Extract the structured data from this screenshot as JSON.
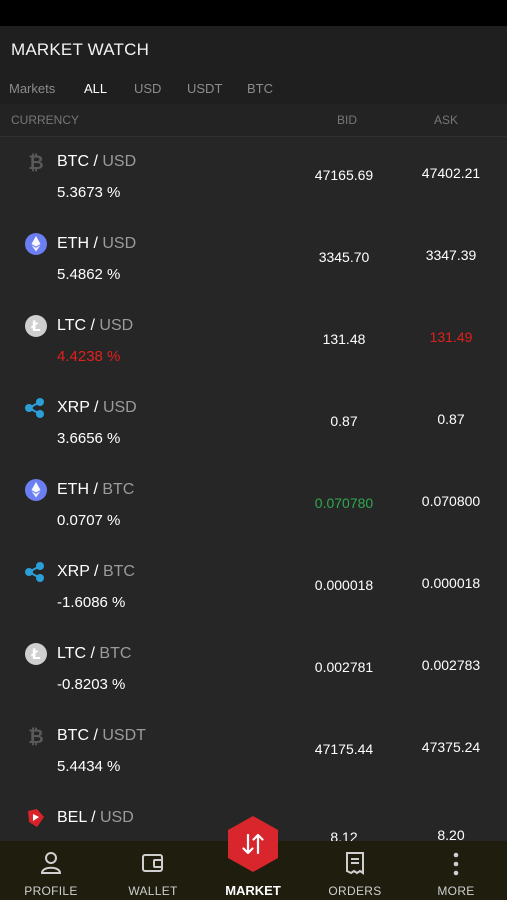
{
  "header": {
    "title": "MARKET WATCH"
  },
  "tabs": [
    "Markets",
    "ALL",
    "USD",
    "USDT",
    "BTC"
  ],
  "columns": {
    "currency": "CURRENCY",
    "bid": "BID",
    "ask": "ASK"
  },
  "rows": [
    {
      "base": "BTC",
      "sep": " / ",
      "quote": "USD",
      "change": "5.3673 %",
      "bid": "47165.69",
      "ask": "47402.21",
      "icon": "bitcoin-icon"
    },
    {
      "base": "ETH",
      "sep": " / ",
      "quote": "USD",
      "change": "5.4862 %",
      "bid": "3345.70",
      "ask": "3347.39",
      "icon": "ethereum-icon"
    },
    {
      "base": "LTC",
      "sep": " / ",
      "quote": "USD",
      "change": "4.4238 %",
      "bid": "131.48",
      "ask": "131.49",
      "icon": "litecoin-icon"
    },
    {
      "base": "XRP",
      "sep": " / ",
      "quote": "USD",
      "change": "3.6656 %",
      "bid": "0.87",
      "ask": "0.87",
      "icon": "xrp-icon"
    },
    {
      "base": "ETH",
      "sep": " / ",
      "quote": "BTC",
      "change": "0.0707 %",
      "bid": "0.070780",
      "ask": "0.070800",
      "icon": "ethereum-icon"
    },
    {
      "base": "XRP",
      "sep": " / ",
      "quote": "BTC",
      "change": "-1.6086 %",
      "bid": "0.000018",
      "ask": "0.000018",
      "icon": "xrp-icon"
    },
    {
      "base": "LTC",
      "sep": " / ",
      "quote": "BTC",
      "change": "-0.8203 %",
      "bid": "0.002781",
      "ask": "0.002783",
      "icon": "litecoin-icon"
    },
    {
      "base": "BTC",
      "sep": " / ",
      "quote": "USDT",
      "change": "5.4434 %",
      "bid": "47175.44",
      "ask": "47375.24",
      "icon": "bitcoin-icon"
    },
    {
      "base": "BEL",
      "sep": " / ",
      "quote": "USD",
      "change": "",
      "bid": "8.12",
      "ask": "8.20",
      "icon": "bel-icon"
    }
  ],
  "colors": {
    "red": "#e0201c",
    "green": "#2fa84f",
    "accent": "#d9262c"
  },
  "nav": {
    "profile": "PROFILE",
    "wallet": "WALLET",
    "market": "MARKET",
    "orders": "ORDERS",
    "more": "MORE"
  }
}
